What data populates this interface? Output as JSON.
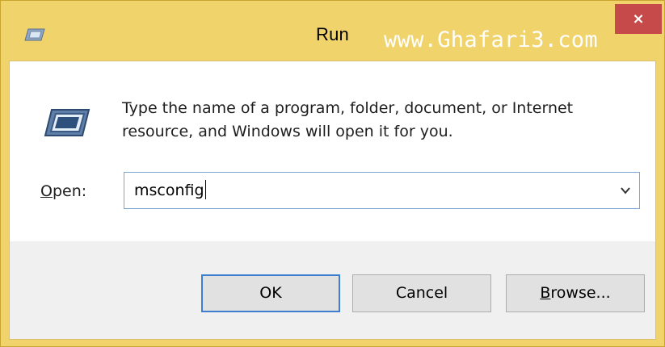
{
  "window": {
    "title": "Run",
    "watermark": "www.Ghafari3.com",
    "close_glyph": "×",
    "icons": {
      "title": "run-window-icon",
      "close": "close-icon",
      "dialog": "run-program-icon",
      "dropdown": "chevron-down-icon"
    }
  },
  "dialog": {
    "description": "Type the name of a program, folder, document, or Internet resource, and Windows will open it for you.",
    "open_label_accel": "O",
    "open_label_rest": "pen:",
    "open_value": "msconfig"
  },
  "buttons": {
    "ok": "OK",
    "cancel": "Cancel",
    "browse_accel": "B",
    "browse_rest": "rowse..."
  },
  "colors": {
    "title_bar": "#f0d36b",
    "close_button": "#c74a4a",
    "default_button_border": "#3c7fd1",
    "input_border": "#7aa7d6"
  }
}
